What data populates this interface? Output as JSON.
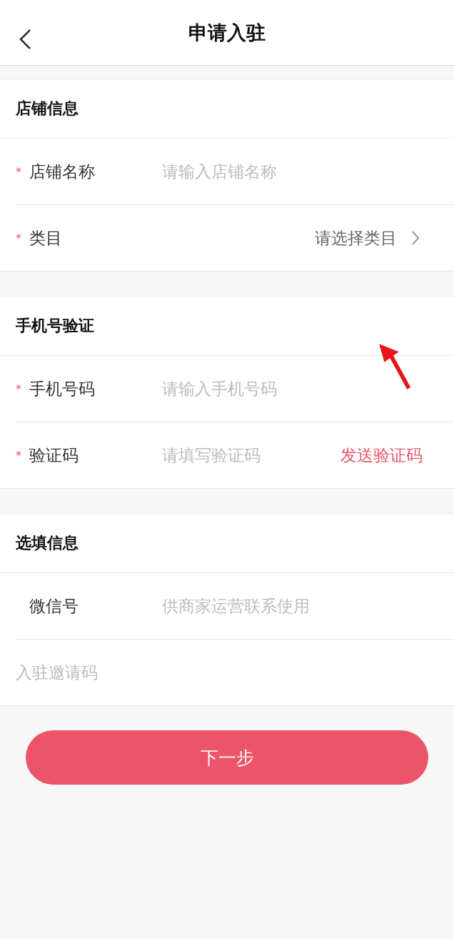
{
  "header": {
    "title": "申请入驻"
  },
  "sections": [
    {
      "title": "店铺信息",
      "rows": [
        {
          "kind": "input",
          "mark": "*",
          "label": "店铺名称",
          "placeholder": "请输入店铺名称"
        },
        {
          "kind": "select",
          "mark": "*",
          "label": "类目",
          "value": "请选择类目"
        }
      ]
    },
    {
      "title": "手机号验证",
      "rows": [
        {
          "kind": "input",
          "mark": "*",
          "label": "手机号码",
          "placeholder": "请输入手机号码"
        },
        {
          "kind": "code",
          "mark": "*",
          "label": "验证码",
          "placeholder": "请填写验证码",
          "action": "发送验证码"
        }
      ]
    },
    {
      "title": "选填信息",
      "rows": [
        {
          "kind": "input",
          "label": "微信号",
          "placeholder": "供商家运营联系使用"
        },
        {
          "kind": "bare",
          "placeholder": "入驻邀请码"
        }
      ]
    }
  ],
  "next_button": "下一步"
}
